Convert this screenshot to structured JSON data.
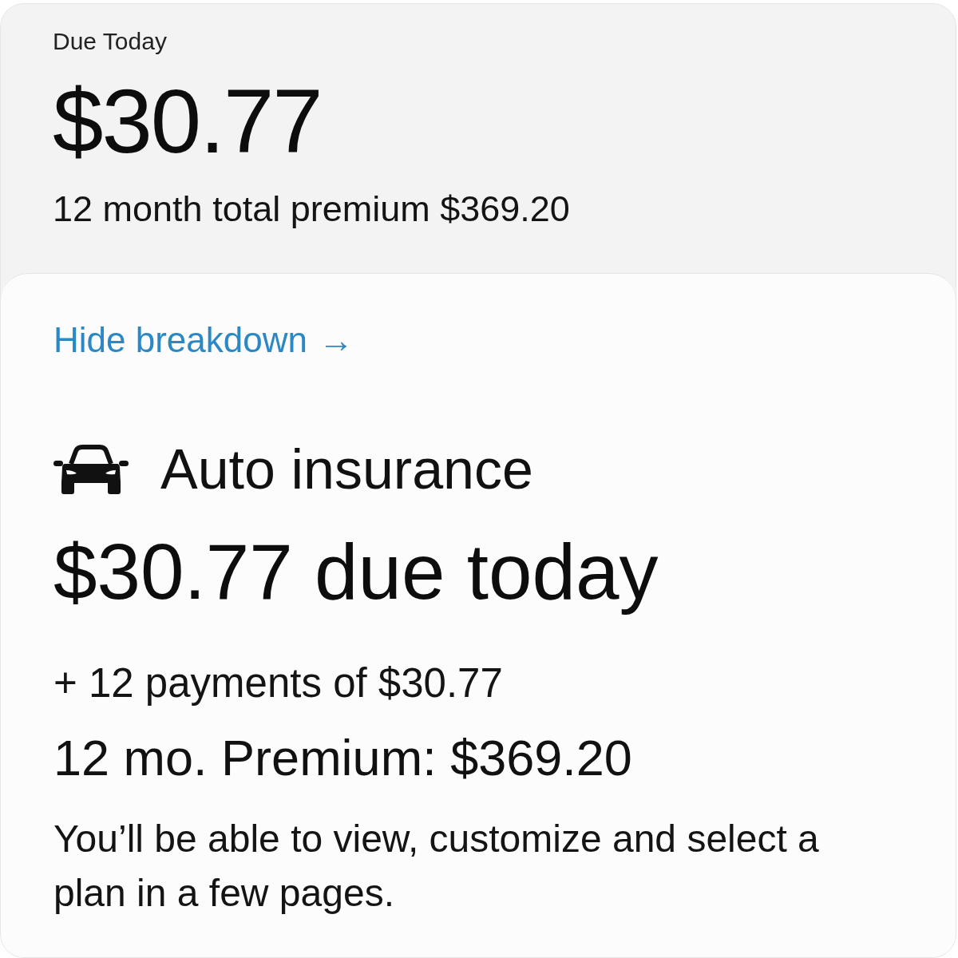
{
  "due_today": {
    "label": "Due Today",
    "amount": "$30.77",
    "total_premium": "12 month total premium $369.20"
  },
  "breakdown": {
    "toggle": {
      "label": "Hide breakdown",
      "arrow": "→"
    },
    "product": {
      "title": "Auto insurance",
      "due": "$30.77 due today",
      "payments": "+ 12 payments of $30.77",
      "premium": "12 mo. Premium: $369.20",
      "note": "You’ll be able to view, customize and select a plan in a few pages."
    }
  }
}
